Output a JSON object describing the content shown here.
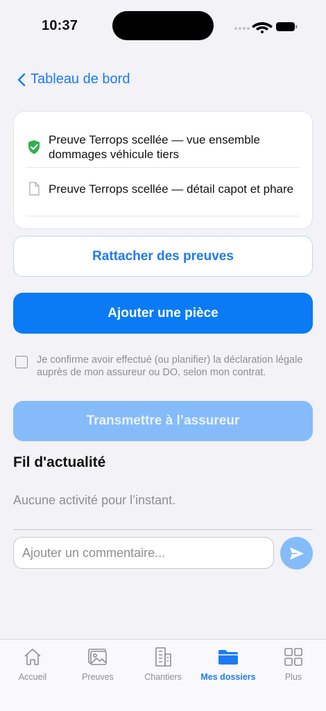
{
  "status_bar": {
    "time": "10:37"
  },
  "nav": {
    "back_label": "Tableau de bord"
  },
  "proofs": [
    {
      "label": "Preuve Terrops scellée — vue ensemble dommages véhicule tiers",
      "icon": "shield-check-icon",
      "sealed": true
    },
    {
      "label": "Preuve Terrops scellée — détail capot et phare",
      "icon": "document-icon",
      "sealed": false
    }
  ],
  "actions": {
    "attach_label": "Rattacher des preuves",
    "add_label": "Ajouter une pièce",
    "confirm_text": "Je confirme avoir effectué (ou planifier) la déclaration légale auprès de mon assureur ou DO, selon mon contrat.",
    "transmit_label": "Transmettre à l’assureur"
  },
  "feed": {
    "title": "Fil d'actualité",
    "empty_text": "Aucune activité pour l’instant.",
    "comment_placeholder": "Ajouter un commentaire..."
  },
  "tabbar": {
    "items": [
      {
        "label": "Accueil",
        "icon": "house-icon",
        "active": false
      },
      {
        "label": "Preuves",
        "icon": "photo-icon",
        "active": false
      },
      {
        "label": "Chantiers",
        "icon": "building-icon",
        "active": false
      },
      {
        "label": "Mes dossiers",
        "icon": "folder-icon",
        "active": true
      },
      {
        "label": "Plus",
        "icon": "grid-icon",
        "active": false
      }
    ]
  },
  "colors": {
    "accent": "#0a7bf5",
    "accent_disabled": "#86bbfa",
    "success": "#2fb24d",
    "background": "#f2f2f7"
  }
}
